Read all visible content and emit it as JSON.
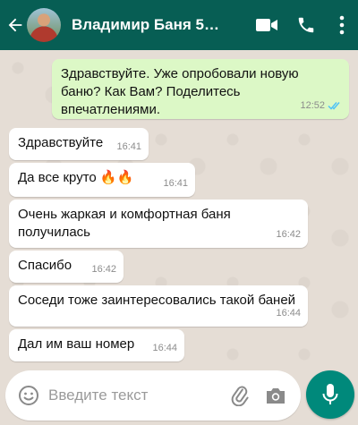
{
  "header": {
    "title": "Владимир Баня 5х6 с ...",
    "bg_color": "#075e54"
  },
  "messages": [
    {
      "direction": "out",
      "text": "Здравствуйте. Уже опробовали новую баню? Как Вам? Поделитесь впечатлениями.",
      "time": "12:52",
      "status": "read"
    },
    {
      "direction": "in",
      "text": "Здравствуйте",
      "time": "16:41"
    },
    {
      "direction": "in",
      "text": "Да все круто 🔥🔥",
      "time": "16:41"
    },
    {
      "direction": "in",
      "text": "Очень жаркая и комфортная баня получилась",
      "time": "16:42"
    },
    {
      "direction": "in",
      "text": "Спасибо",
      "time": "16:42"
    },
    {
      "direction": "in",
      "text": "Соседи тоже заинтересовались такой баней",
      "time": "16:44"
    },
    {
      "direction": "in",
      "text": "Дал им ваш номер",
      "time": "16:44"
    }
  ],
  "composer": {
    "placeholder": "Введите текст"
  },
  "icons": {
    "back": "back-arrow-icon",
    "video": "video-call-icon",
    "phone": "phone-icon",
    "menu": "more-vert-icon",
    "emoji": "emoji-icon",
    "attach": "paperclip-icon",
    "camera": "camera-icon",
    "mic": "mic-icon"
  },
  "colors": {
    "outgoing_bubble": "#dcf8c6",
    "incoming_bubble": "#ffffff",
    "read_ticks": "#4fc3f7",
    "mic_button": "#00897b"
  }
}
